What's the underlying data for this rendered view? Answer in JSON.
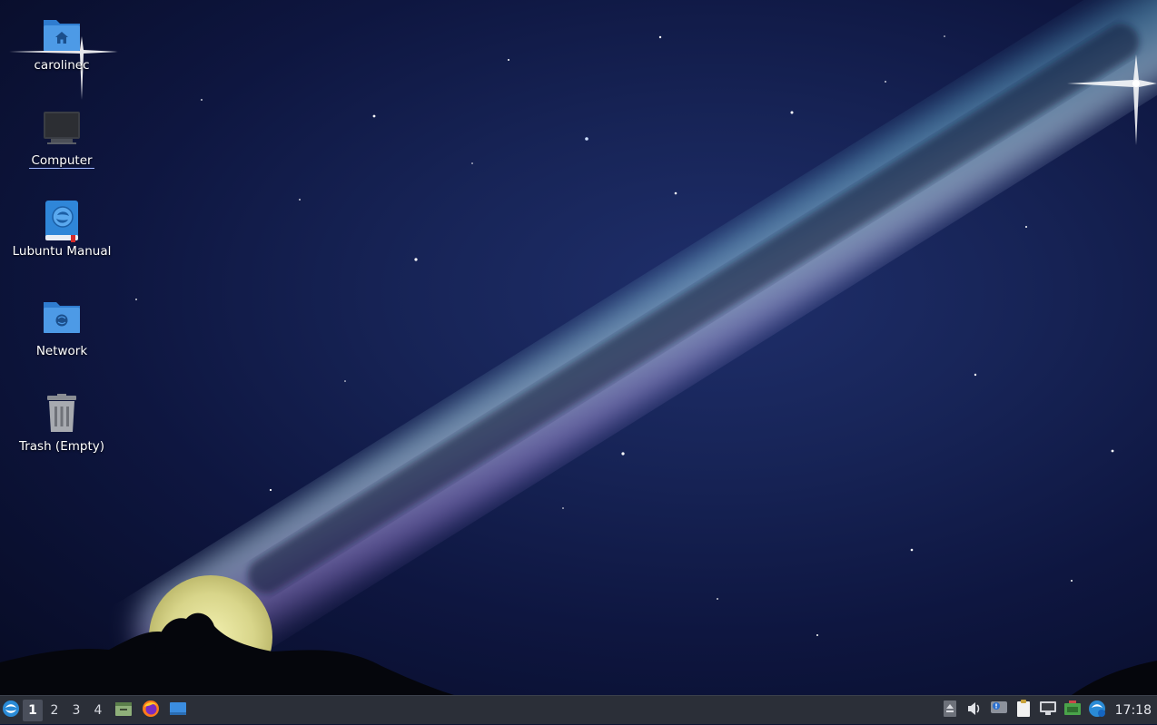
{
  "desktop": {
    "icons": [
      {
        "label": "carolinec",
        "icon": "home-folder-icon"
      },
      {
        "label": "Computer",
        "icon": "computer-icon"
      },
      {
        "label": "Lubuntu Manual",
        "icon": "manual-book-icon"
      },
      {
        "label": "Network",
        "icon": "network-folder-icon"
      },
      {
        "label": "Trash (Empty)",
        "icon": "trash-icon"
      }
    ],
    "selected_icon": "Computer"
  },
  "taskbar": {
    "start_menu_icon": "lubuntu-logo-icon",
    "workspaces": [
      "1",
      "2",
      "3",
      "4"
    ],
    "active_workspace": "1",
    "launchers": [
      "file-manager-icon",
      "firefox-icon",
      "show-desktop-icon"
    ],
    "tray_icons": [
      "eject-icon",
      "volume-icon",
      "notification-icon",
      "clipboard-icon",
      "network-icon",
      "battery-icon",
      "update-notifier-icon"
    ],
    "clock": "17:18"
  },
  "colors": {
    "taskbar_bg": "#2b2f38",
    "folder_blue": "#3d8fdc",
    "sky_dark": "#070b24"
  }
}
